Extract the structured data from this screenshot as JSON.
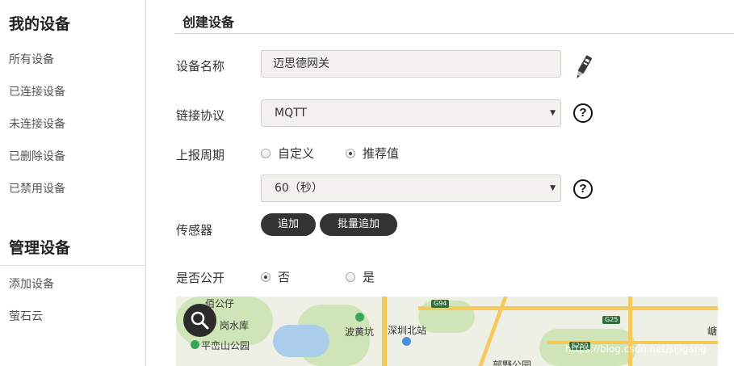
{
  "sidebar": {
    "my_devices_title": "我的设备",
    "my_devices_items": [
      {
        "label": "所有设备"
      },
      {
        "label": "已连接设备"
      },
      {
        "label": "未连接设备"
      },
      {
        "label": "已删除设备"
      },
      {
        "label": "已禁用设备"
      }
    ],
    "manage_title": "管理设备",
    "manage_items": [
      {
        "label": "添加设备"
      },
      {
        "label": "萤石云"
      }
    ]
  },
  "form": {
    "title": "创建设备",
    "device_name_label": "设备名称",
    "device_name_value": "迈思德网关",
    "protocol_label": "链接协议",
    "protocol_value": "MQTT",
    "report_period_label": "上报周期",
    "report_options": [
      {
        "label": "自定义",
        "checked": false
      },
      {
        "label": "推荐值",
        "checked": true
      }
    ],
    "period_value": "60（秒）",
    "sensor_label": "传感器",
    "add_button": "追加",
    "batch_add_button": "批量追加",
    "public_label": "是否公开",
    "public_options": [
      {
        "label": "否",
        "checked": true
      },
      {
        "label": "是",
        "checked": false
      }
    ],
    "help_glyph": "?"
  },
  "map": {
    "labels": [
      "佰公仔",
      "岗水库",
      "平峦山公园",
      "波黄坑",
      "深圳北站",
      "G94",
      "G25",
      "S260",
      "部野公园",
      "嵣"
    ],
    "watermark": "https://blog.csdn.net/sijigang"
  },
  "colors": {
    "button_dark": "#333333",
    "input_bg": "#f2f1ee"
  }
}
